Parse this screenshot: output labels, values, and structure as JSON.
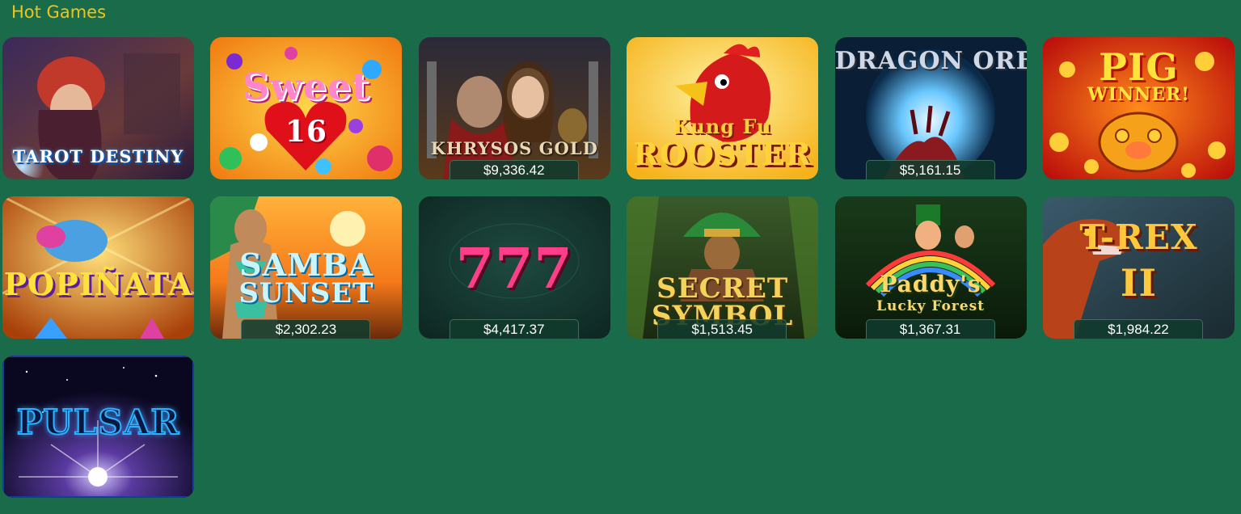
{
  "section": {
    "title": "Hot Games"
  },
  "games": [
    {
      "id": "tarot-destiny",
      "title": "TAROT DESTINY",
      "jackpot": ""
    },
    {
      "id": "sweet-16",
      "title": "Sweet",
      "subtitle": "16",
      "jackpot": ""
    },
    {
      "id": "khrysos-gold",
      "title": "KHRYSOS GOLD",
      "jackpot": "$9,336.42"
    },
    {
      "id": "kung-fu-rooster",
      "title": "Kung Fu",
      "subtitle": "ROOSTER",
      "jackpot": ""
    },
    {
      "id": "dragon-orb",
      "title": "DRAGON ORB",
      "jackpot": "$5,161.15"
    },
    {
      "id": "pig-winner",
      "title": "PIG",
      "subtitle": "WINNER!",
      "jackpot": ""
    },
    {
      "id": "popinata",
      "title": "POPIÑATA",
      "jackpot": ""
    },
    {
      "id": "samba-sunset",
      "title": "SAMBA",
      "subtitle": "SUNSET",
      "jackpot": "$2,302.23"
    },
    {
      "id": "777",
      "title": "777",
      "jackpot": "$4,417.37"
    },
    {
      "id": "secret-symbol",
      "title": "SECRET",
      "subtitle": "SYMBOL",
      "jackpot": "$1,513.45"
    },
    {
      "id": "paddys-lucky-forest",
      "title": "Paddy's",
      "subtitle": "Lucky Forest",
      "jackpot": "$1,367.31"
    },
    {
      "id": "t-rex-ii",
      "title": "T-REX",
      "subtitle": "II",
      "jackpot": "$1,984.22"
    },
    {
      "id": "pulsar",
      "title": "PULSAR",
      "jackpot": ""
    }
  ],
  "colors": {
    "background": "#1a6b49",
    "title": "#f0c419",
    "jackpot_bg": "#103a2c",
    "jackpot_text": "#ffffff"
  }
}
